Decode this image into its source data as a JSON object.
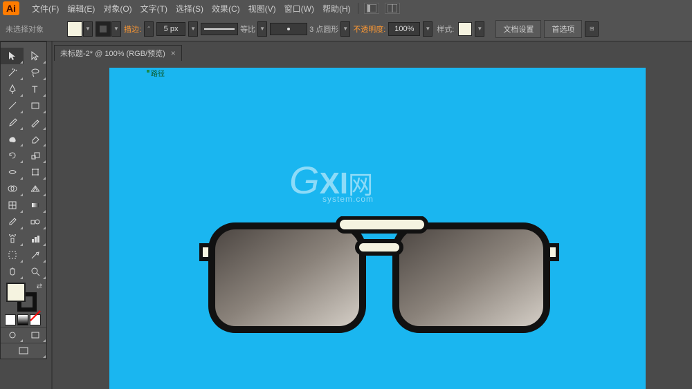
{
  "menubar": {
    "logo": "Ai",
    "items": [
      "文件(F)",
      "编辑(E)",
      "对象(O)",
      "文字(T)",
      "选择(S)",
      "效果(C)",
      "视图(V)",
      "窗口(W)",
      "帮助(H)"
    ]
  },
  "controlbar": {
    "selection": "未选择对象",
    "stroke_label": "描边:",
    "stroke_width": "5 px",
    "profile_label": "等比",
    "brush_label": "3 点圆形",
    "opacity_label": "不透明度:",
    "opacity_value": "100%",
    "style_label": "样式:",
    "doc_setup": "文档设置",
    "prefs": "首选项"
  },
  "document": {
    "tab_title": "未标题-2* @ 100% (RGB/预览)",
    "path_indicator": "路径"
  },
  "watermark": {
    "g": "G",
    "xi": "XI",
    "w": "网",
    "sys": "system.com"
  },
  "colors": {
    "fill": "#f5f3e0",
    "stroke": "#111111",
    "artboard": "#1ab6f0"
  }
}
